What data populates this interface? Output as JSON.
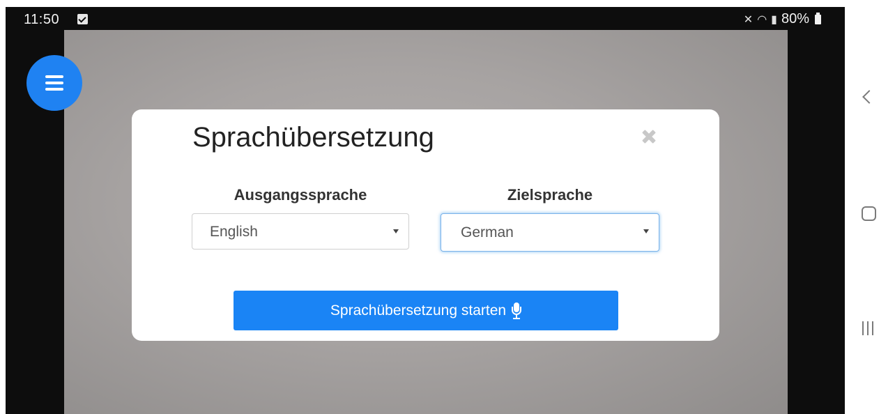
{
  "status_bar": {
    "time": "11:50",
    "battery": "80%",
    "icons": [
      "notification-check-icon",
      "mute-icon",
      "wifi-icon",
      "wifi-calling-icon",
      "signal-icon",
      "battery-icon"
    ]
  },
  "menu_button": {
    "icon": "hamburger-menu-icon"
  },
  "dialog": {
    "title": "Sprachübersetzung",
    "close_icon": "close-icon",
    "source_label": "Ausgangssprache",
    "source_value": "English",
    "target_label": "Zielsprache",
    "target_value": "German",
    "start_button_label": "Sprachübersetzung starten",
    "start_button_icon": "microphone-icon"
  },
  "colors": {
    "accent": "#1a84f5",
    "focus_ring": "#66afe9"
  },
  "nav_bar": {
    "items": [
      "back-icon",
      "home-icon",
      "recents-icon"
    ]
  }
}
